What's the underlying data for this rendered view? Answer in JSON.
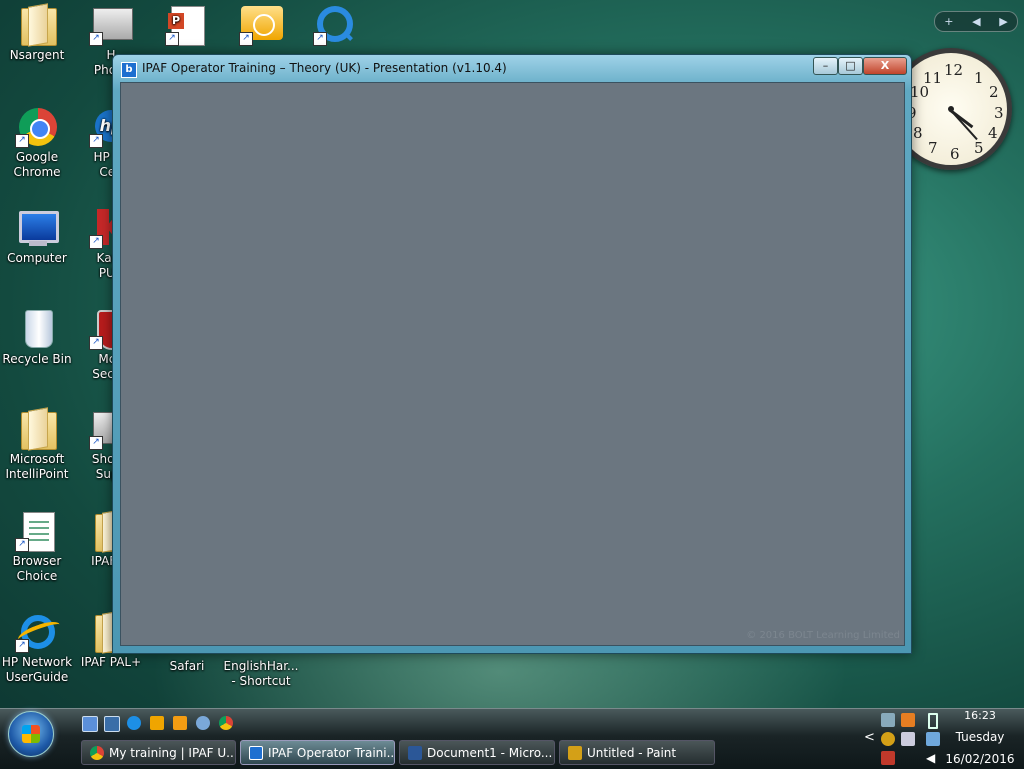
{
  "desktop": {
    "icons": [
      {
        "label": "Nsargent"
      },
      {
        "label": "H\nPhoto"
      },
      {
        "label": ""
      },
      {
        "label": ""
      },
      {
        "label": ""
      },
      {
        "label": "Google\nChrome"
      },
      {
        "label": "HP So\nCen"
      },
      {
        "label": "Computer"
      },
      {
        "label": "Kasp\nPUR"
      },
      {
        "label": "Recycle Bin"
      },
      {
        "label": "McA\nSecuri"
      },
      {
        "label": "Microsoft\nIntelliPoint"
      },
      {
        "label": "Shop f\nSupp"
      },
      {
        "label": "Browser\nChoice"
      },
      {
        "label": "IPAF Ja"
      },
      {
        "label": "HP Network\nUserGuide"
      },
      {
        "label": "IPAF PAL+"
      },
      {
        "label": "Safari"
      },
      {
        "label": "EnglishHar...\n- Shortcut"
      }
    ]
  },
  "gadget_bar": {
    "add": "+",
    "prev": "◀",
    "next": "▶"
  },
  "clock": {
    "numbers": [
      "12",
      "1",
      "2",
      "3",
      "4",
      "5",
      "6",
      "7",
      "8",
      "9",
      "10",
      "11"
    ]
  },
  "window": {
    "title": "IPAF Operator Training – Theory (UK) - Presentation (v1.10.4)",
    "minimize": "–",
    "maximize": "□",
    "close": "X",
    "copyright": "© 2016 BOLT Learning Limited"
  },
  "taskbar": {
    "tasks": [
      {
        "label": "My training | IPAF U..."
      },
      {
        "label": "IPAF Operator Traini..."
      },
      {
        "label": "Document1 - Micro..."
      },
      {
        "label": "Untitled - Paint"
      }
    ],
    "time": "16:23",
    "day": "Tuesday",
    "date": "16/02/2016",
    "tray_chevron": "<"
  },
  "colors": {
    "client_bg": "#6b7680",
    "accent": "#1e6fd0"
  }
}
